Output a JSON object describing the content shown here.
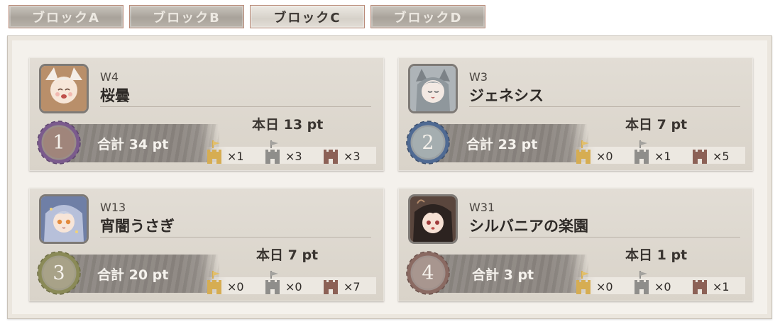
{
  "tabs": [
    {
      "label": "ブロックA",
      "active": false
    },
    {
      "label": "ブロックB",
      "active": false
    },
    {
      "label": "ブロックC",
      "active": true
    },
    {
      "label": "ブロックD",
      "active": false
    }
  ],
  "cards": [
    {
      "world": "W4",
      "name": "桜曇",
      "today": "本日 13 pt",
      "total": "合計 34 pt",
      "rank": "1",
      "counts": {
        "gold": "×1",
        "silver": "×3",
        "bronze": "×3"
      },
      "avatar_icon": "character-avatar-icon"
    },
    {
      "world": "W3",
      "name": "ジェネシス",
      "today": "本日 7 pt",
      "total": "合計 23 pt",
      "rank": "2",
      "counts": {
        "gold": "×0",
        "silver": "×1",
        "bronze": "×5"
      },
      "avatar_icon": "character-avatar-icon"
    },
    {
      "world": "W13",
      "name": "宵闇うさぎ",
      "today": "本日 7 pt",
      "total": "合計 20 pt",
      "rank": "3",
      "counts": {
        "gold": "×0",
        "silver": "×0",
        "bronze": "×7"
      },
      "avatar_icon": "character-avatar-icon"
    },
    {
      "world": "W31",
      "name": "シルバニアの楽園",
      "today": "本日 1 pt",
      "total": "合計 3 pt",
      "rank": "4",
      "counts": {
        "gold": "×0",
        "silver": "×0",
        "bronze": "×1"
      },
      "avatar_icon": "character-avatar-icon"
    }
  ],
  "colors": {
    "gold_castle": "#d6ad52",
    "silver_castle": "#8f8e8b",
    "bronze_castle": "#8c6156",
    "rank1_ring": "#7b5b8d",
    "rank2_ring": "#4f6a93",
    "rank3_ring": "#8a8a57",
    "rank4_ring": "#8a6a62"
  }
}
